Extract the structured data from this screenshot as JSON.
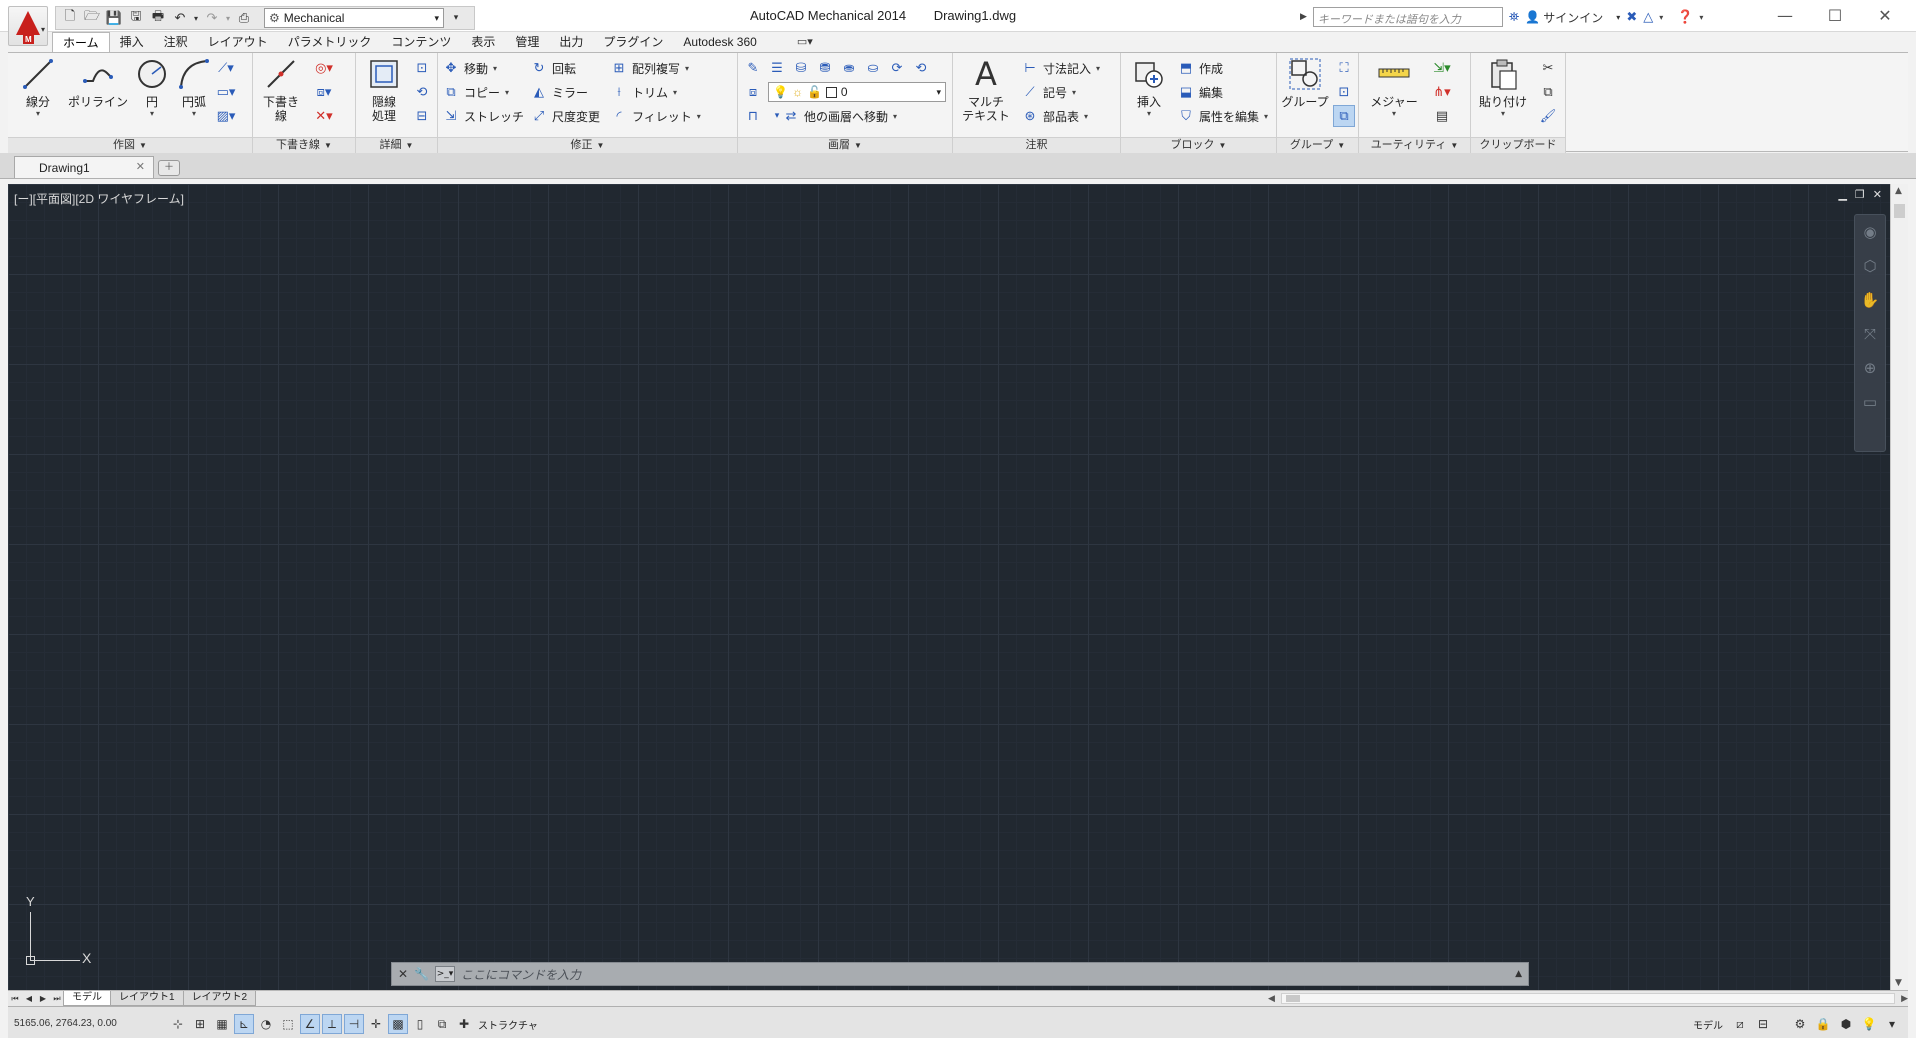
{
  "window": {
    "app_title": "AutoCAD Mechanical 2014",
    "file_name": "Drawing1.dwg",
    "logo_letter": "M",
    "minimize": "—",
    "restore": "☐",
    "close": "✕"
  },
  "quick_access": {
    "workspace": "Mechanical"
  },
  "search": {
    "placeholder": "キーワードまたは語句を入力"
  },
  "account": {
    "signin_label": "サインイン"
  },
  "ribbon_tabs": [
    {
      "label": "ホーム"
    },
    {
      "label": "挿入"
    },
    {
      "label": "注釈"
    },
    {
      "label": "レイアウト"
    },
    {
      "label": "パラメトリック"
    },
    {
      "label": "コンテンツ"
    },
    {
      "label": "表示"
    },
    {
      "label": "管理"
    },
    {
      "label": "出力"
    },
    {
      "label": "プラグイン"
    },
    {
      "label": "Autodesk 360"
    }
  ],
  "panels": {
    "draw": {
      "title": "作図",
      "line": "線分",
      "polyline": "ポリライン",
      "circle": "円",
      "arc": "円弧"
    },
    "construction": {
      "title": "下書き線",
      "construction_line_1": "下書き",
      "construction_line_2": "線"
    },
    "detail": {
      "title": "詳細",
      "hide_line_1": "隠線",
      "hide_line_2": "処理"
    },
    "modify": {
      "title": "修正",
      "move": "移動",
      "rotate": "回転",
      "array": "配列複写",
      "copy": "コピー",
      "mirror": "ミラー",
      "trim": "トリム",
      "stretch": "ストレッチ",
      "scale": "尺度変更",
      "fillet": "フィレット"
    },
    "layers": {
      "title": "画層",
      "current_layer": "0",
      "move_to_layer": "他の画層へ移動"
    },
    "annotation": {
      "title": "注釈",
      "mtext_1": "マルチ",
      "mtext_2": "テキスト",
      "mtext_glyph": "A",
      "dimension": "寸法記入",
      "symbol": "記号",
      "bom": "部品表"
    },
    "block": {
      "title": "ブロック",
      "insert": "挿入",
      "create": "作成",
      "edit": "編集",
      "edit_attributes": "属性を編集"
    },
    "group": {
      "title": "グループ",
      "group": "グループ"
    },
    "utilities": {
      "title": "ユーティリティ",
      "measure": "メジャー"
    },
    "clipboard": {
      "title": "クリップボード",
      "paste": "貼り付け"
    }
  },
  "document_tabs": [
    {
      "label": "Drawing1"
    }
  ],
  "viewport": {
    "label": "[ー][平面図][2D ワイヤフレーム]",
    "ucs_x": "X",
    "ucs_y": "Y"
  },
  "command_line": {
    "placeholder": "ここにコマンドを入力"
  },
  "layout_tabs": [
    {
      "label": "モデル"
    },
    {
      "label": "レイアウト1"
    },
    {
      "label": "レイアウト2"
    }
  ],
  "status": {
    "coordinates": "5165.06, 2764.23, 0.00",
    "structure": "ストラクチャ",
    "model": "モデル"
  }
}
